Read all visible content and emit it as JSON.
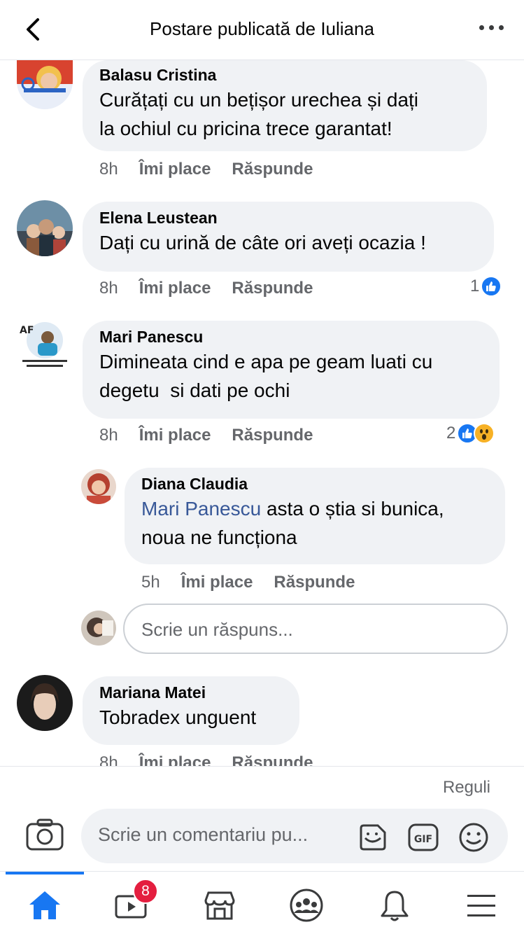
{
  "header": {
    "title": "Postare publicată de Iuliana"
  },
  "actions": {
    "like": "Îmi place",
    "reply": "Răspunde"
  },
  "comments": [
    {
      "author": "Balasu Cristina",
      "text_lines": [
        "Curățați cu un bețișor urechea și dați",
        "la ochiul cu pricina trece garantat!"
      ],
      "time": "8h"
    },
    {
      "author": "Elena Leustean",
      "text_lines": [
        "Dați cu urină de câte ori aveți ocazia !"
      ],
      "time": "8h",
      "reaction_count": "1"
    },
    {
      "author": "Mari Panescu",
      "text_lines": [
        "Dimineata cind e apa pe geam luati cu",
        "degetu  si dati pe ochi"
      ],
      "time": "8h",
      "reaction_count": "2"
    },
    {
      "author": "Diana Claudia",
      "mention": "Mari Panescu",
      "text_lines": [
        " asta o știa si bunica,",
        "noua ne funcționa"
      ],
      "time": "5h"
    },
    {
      "author": "Mariana Matei",
      "text_lines": [
        "Tobradex unguent"
      ],
      "time": "8h"
    }
  ],
  "reply_input": {
    "placeholder": "Scrie un răspuns..."
  },
  "composer": {
    "rules": "Reguli",
    "placeholder": "Scrie un comentariu pu..."
  },
  "nav": {
    "watch_badge": "8"
  },
  "colors": {
    "accent": "#1877f2",
    "bubble": "#f0f2f5",
    "muted": "#65676b",
    "mention": "#385898",
    "badge": "#e41e3f"
  },
  "icons": [
    "back-arrow-icon",
    "more-icon",
    "like-icon",
    "wow-icon",
    "camera-icon",
    "sticker-icon",
    "gif-icon",
    "emoji-icon",
    "home-icon",
    "watch-icon",
    "marketplace-icon",
    "groups-icon",
    "bell-icon",
    "menu-icon"
  ]
}
